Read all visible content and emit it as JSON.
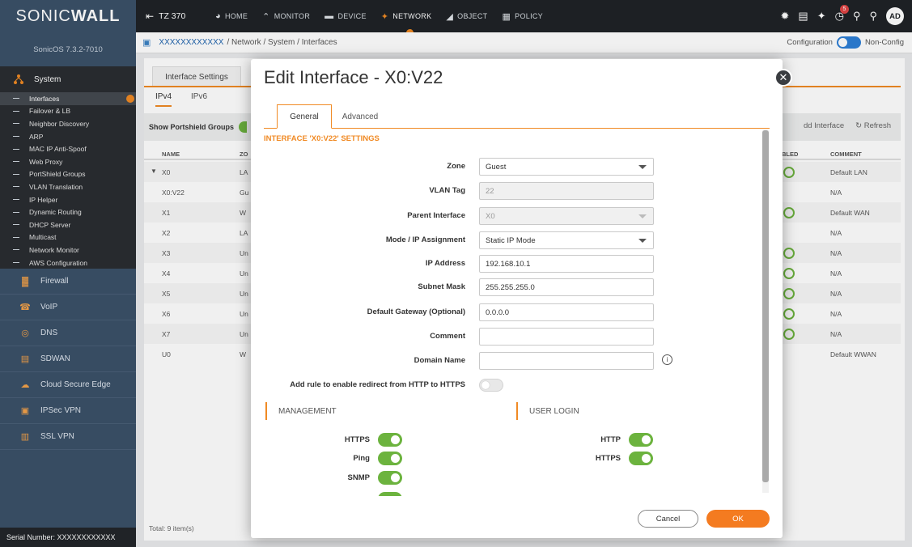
{
  "brand": {
    "name_a": "SONIC",
    "name_b": "WALL",
    "version": "SonicOS 7.3.2-7010",
    "serial": "Serial Number: XXXXXXXXXXXX"
  },
  "sidebar": {
    "system_label": "System",
    "sub_items": [
      "Interfaces",
      "Failover & LB",
      "Neighbor Discovery",
      "ARP",
      "MAC IP Anti-Spoof",
      "Web Proxy",
      "PortShield Groups",
      "VLAN Translation",
      "IP Helper",
      "Dynamic Routing",
      "DHCP Server",
      "Multicast",
      "Network Monitor",
      "AWS Configuration"
    ],
    "nav_items": [
      {
        "label": "Firewall",
        "icon": "firewall-icon"
      },
      {
        "label": "VoIP",
        "icon": "phone-icon"
      },
      {
        "label": "DNS",
        "icon": "globe-icon"
      },
      {
        "label": "SDWAN",
        "icon": "sdwan-icon"
      },
      {
        "label": "Cloud Secure Edge",
        "icon": "cloud-icon"
      },
      {
        "label": "IPSec VPN",
        "icon": "vpn-icon"
      },
      {
        "label": "SSL VPN",
        "icon": "ssl-vpn-icon"
      }
    ]
  },
  "topbar": {
    "device": "TZ 370",
    "tabs": [
      {
        "label": "HOME"
      },
      {
        "label": "MONITOR"
      },
      {
        "label": "DEVICE"
      },
      {
        "label": "NETWORK"
      },
      {
        "label": "OBJECT"
      },
      {
        "label": "POLICY"
      }
    ],
    "notification_count": "5",
    "user_initials": "AD"
  },
  "breadcrumb": {
    "device": "XXXXXXXXXXXX",
    "path": "/ Network / System / Interfaces",
    "config_label": "Configuration",
    "nonconfig_label": "Non-Config"
  },
  "background": {
    "tab": "Interface Settings",
    "ip_tabs": [
      "IPv4",
      "IPv6"
    ],
    "show_groups": "Show Portshield Groups",
    "add_interface": "dd Interface",
    "refresh": "Refresh",
    "headers": {
      "name": "NAME",
      "zone": "ZO",
      "enabled": "BLED",
      "comment": "COMMENT"
    },
    "rows": [
      {
        "name": "X0",
        "zone": "LA",
        "comment": "Default LAN",
        "ring": true
      },
      {
        "name": "X0:V22",
        "zone": "Gu",
        "comment": "N/A",
        "ring": false
      },
      {
        "name": "X1",
        "zone": "W",
        "comment": "Default WAN",
        "ring": true
      },
      {
        "name": "X2",
        "zone": "LA",
        "comment": "N/A",
        "ring": false
      },
      {
        "name": "X3",
        "zone": "Un",
        "comment": "N/A",
        "ring": true
      },
      {
        "name": "X4",
        "zone": "Un",
        "comment": "N/A",
        "ring": true
      },
      {
        "name": "X5",
        "zone": "Un",
        "comment": "N/A",
        "ring": true
      },
      {
        "name": "X6",
        "zone": "Un",
        "comment": "N/A",
        "ring": true
      },
      {
        "name": "X7",
        "zone": "Un",
        "comment": "N/A",
        "ring": true
      },
      {
        "name": "U0",
        "zone": "W",
        "comment": "Default WWAN",
        "ring": false
      }
    ],
    "total": "Total: 9 item(s)"
  },
  "modal": {
    "title": "Edit Interface - X0:V22",
    "tabs": [
      "General",
      "Advanced"
    ],
    "section": "INTERFACE 'X0:V22' SETTINGS",
    "fields": {
      "zone": {
        "label": "Zone",
        "value": "Guest"
      },
      "vlan": {
        "label": "VLAN Tag",
        "value": "22"
      },
      "parent": {
        "label": "Parent Interface",
        "value": "X0"
      },
      "mode": {
        "label": "Mode / IP Assignment",
        "value": "Static IP Mode"
      },
      "ip": {
        "label": "IP Address",
        "value": "192.168.10.1"
      },
      "mask": {
        "label": "Subnet Mask",
        "value": "255.255.255.0"
      },
      "gateway": {
        "label": "Default Gateway (Optional)",
        "value": "0.0.0.0"
      },
      "comment": {
        "label": "Comment",
        "value": ""
      },
      "domain": {
        "label": "Domain Name",
        "value": ""
      },
      "redirect": {
        "label": "Add rule to enable redirect from HTTP to HTTPS"
      }
    },
    "management": {
      "title": "MANAGEMENT",
      "items": [
        "HTTPS",
        "Ping",
        "SNMP"
      ]
    },
    "user_login": {
      "title": "USER LOGIN",
      "items": [
        "HTTP",
        "HTTPS"
      ]
    },
    "cancel": "Cancel",
    "ok": "OK"
  },
  "colors": {
    "accent": "#f08a24",
    "toggle_on": "#6cb33e",
    "sidebar": "#3b5169",
    "topbar": "#1f2327"
  }
}
